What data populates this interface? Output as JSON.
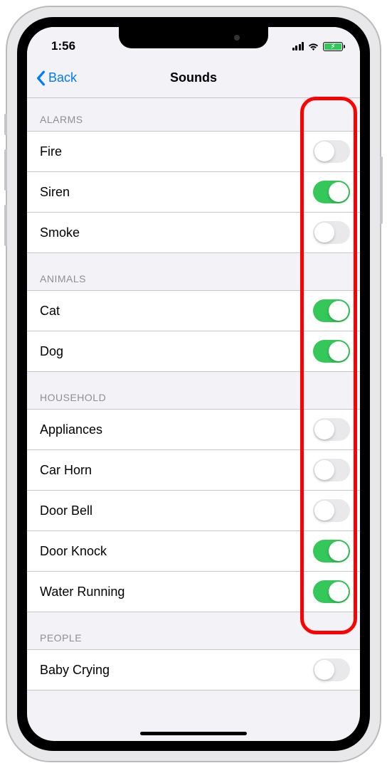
{
  "status": {
    "time": "1:56"
  },
  "nav": {
    "back": "Back",
    "title": "Sounds"
  },
  "sections": [
    {
      "title": "Alarms",
      "items": [
        {
          "label": "Fire",
          "on": false
        },
        {
          "label": "Siren",
          "on": true
        },
        {
          "label": "Smoke",
          "on": false
        }
      ]
    },
    {
      "title": "Animals",
      "items": [
        {
          "label": "Cat",
          "on": true
        },
        {
          "label": "Dog",
          "on": true
        }
      ]
    },
    {
      "title": "Household",
      "items": [
        {
          "label": "Appliances",
          "on": false
        },
        {
          "label": "Car Horn",
          "on": false
        },
        {
          "label": "Door Bell",
          "on": false
        },
        {
          "label": "Door Knock",
          "on": true
        },
        {
          "label": "Water Running",
          "on": true
        }
      ]
    },
    {
      "title": "People",
      "items": [
        {
          "label": "Baby Crying",
          "on": false
        }
      ]
    }
  ]
}
